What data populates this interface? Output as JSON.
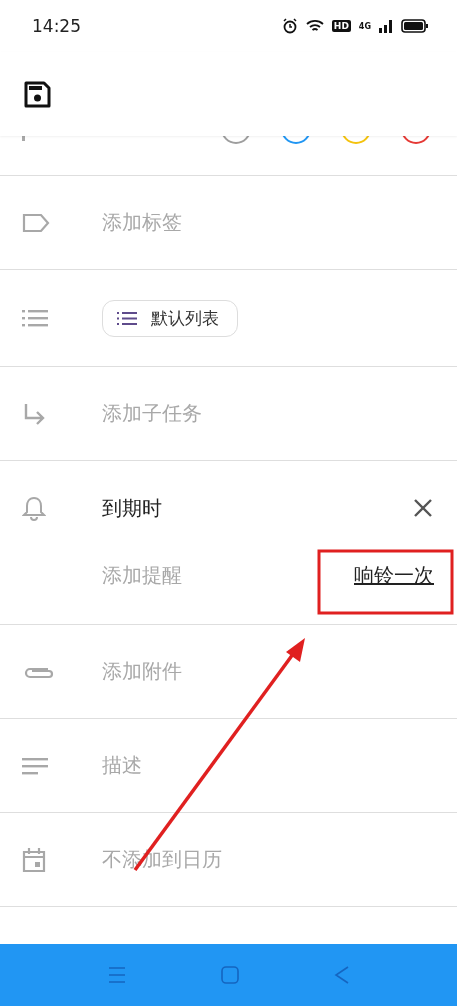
{
  "status_bar": {
    "time": "14:25",
    "hd": "HD",
    "network": "4G"
  },
  "priority": {
    "options": [
      {
        "color": "#9e9e9e"
      },
      {
        "color": "#2196f3"
      },
      {
        "color": "#f4c20d"
      },
      {
        "color": "#e53935"
      }
    ]
  },
  "rows": [
    {
      "kind": "tag",
      "placeholder": "添加标签"
    },
    {
      "kind": "list",
      "chip": "默认列表"
    },
    {
      "kind": "subtask",
      "placeholder": "添加子任务"
    },
    {
      "kind": "due",
      "title": "到期时",
      "placeholder": "添加提醒",
      "action": "响铃一次"
    },
    {
      "kind": "attachment",
      "placeholder": "添加附件"
    },
    {
      "kind": "description",
      "placeholder": "描述"
    },
    {
      "kind": "calendar",
      "placeholder": "不添加到日历"
    }
  ]
}
